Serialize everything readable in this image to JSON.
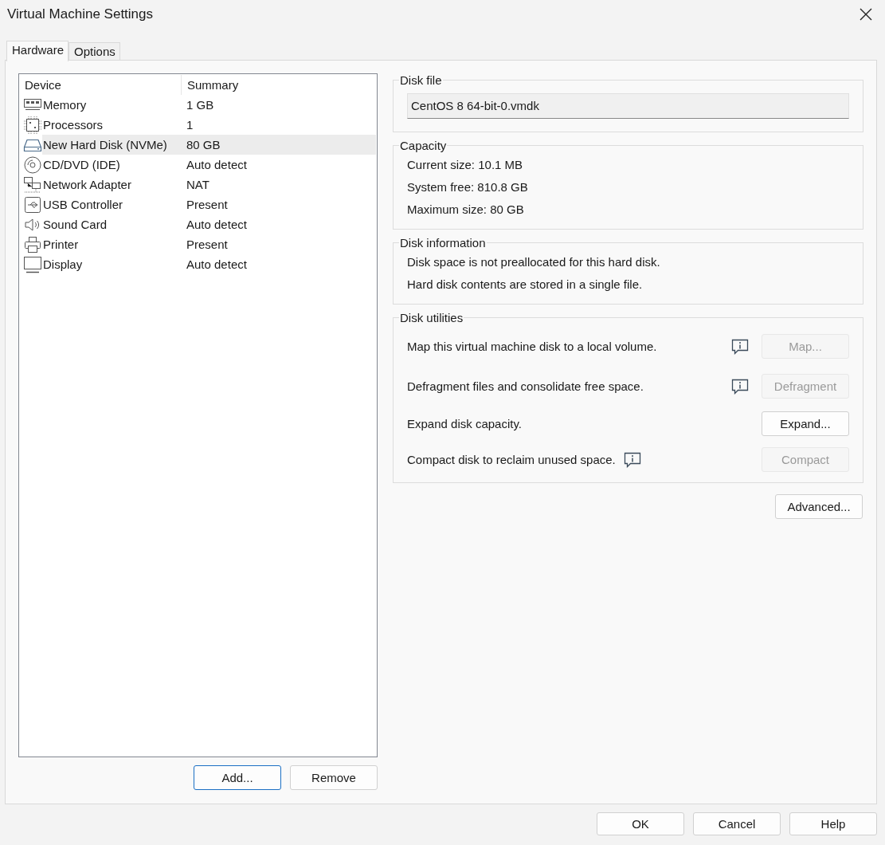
{
  "window": {
    "title": "Virtual Machine Settings"
  },
  "tabs": [
    {
      "label": "Hardware",
      "selected": true
    },
    {
      "label": "Options",
      "selected": false
    }
  ],
  "device_list": {
    "columns": [
      "Device",
      "Summary"
    ],
    "rows": [
      {
        "kind": "memory",
        "device": "Memory",
        "summary": "1 GB",
        "selected": false
      },
      {
        "kind": "processor",
        "device": "Processors",
        "summary": "1",
        "selected": false
      },
      {
        "kind": "disk",
        "device": "New Hard Disk (NVMe)",
        "summary": "80 GB",
        "selected": true
      },
      {
        "kind": "cd",
        "device": "CD/DVD (IDE)",
        "summary": "Auto detect",
        "selected": false
      },
      {
        "kind": "network",
        "device": "Network Adapter",
        "summary": "NAT",
        "selected": false
      },
      {
        "kind": "usb",
        "device": "USB Controller",
        "summary": "Present",
        "selected": false
      },
      {
        "kind": "sound",
        "device": "Sound Card",
        "summary": "Auto detect",
        "selected": false
      },
      {
        "kind": "printer",
        "device": "Printer",
        "summary": "Present",
        "selected": false
      },
      {
        "kind": "display",
        "device": "Display",
        "summary": "Auto detect",
        "selected": false
      }
    ]
  },
  "list_buttons": [
    {
      "label": "Add...",
      "focused": true
    },
    {
      "label": "Remove",
      "focused": false
    }
  ],
  "disk_file": {
    "title": "Disk file",
    "value": "CentOS 8 64-bit-0.vmdk"
  },
  "capacity": {
    "title": "Capacity",
    "lines": [
      "Current size: 10.1 MB",
      "System free: 810.8 GB",
      "Maximum size: 80 GB"
    ]
  },
  "disk_information": {
    "title": "Disk information",
    "lines": [
      "Disk space is not preallocated for this hard disk.",
      "Hard disk contents are stored in a single file."
    ]
  },
  "disk_utilities": {
    "title": "Disk utilities",
    "rows": [
      {
        "kind": "hint",
        "text": "Map this virtual machine disk to a local volume.",
        "button": "Map...",
        "disabled": true
      },
      {
        "kind": "hint",
        "text": "Defragment files and consolidate free space.",
        "button": "Defragment",
        "disabled": true
      },
      {
        "kind": "plain",
        "text": "Expand disk capacity.",
        "button": "Expand...",
        "disabled": false
      },
      {
        "kind": "hint-inline",
        "text": "Compact disk to reclaim unused space.",
        "button": "Compact",
        "disabled": true
      }
    ]
  },
  "advanced_button": "Advanced...",
  "dialog_buttons": [
    "OK",
    "Cancel",
    "Help"
  ]
}
